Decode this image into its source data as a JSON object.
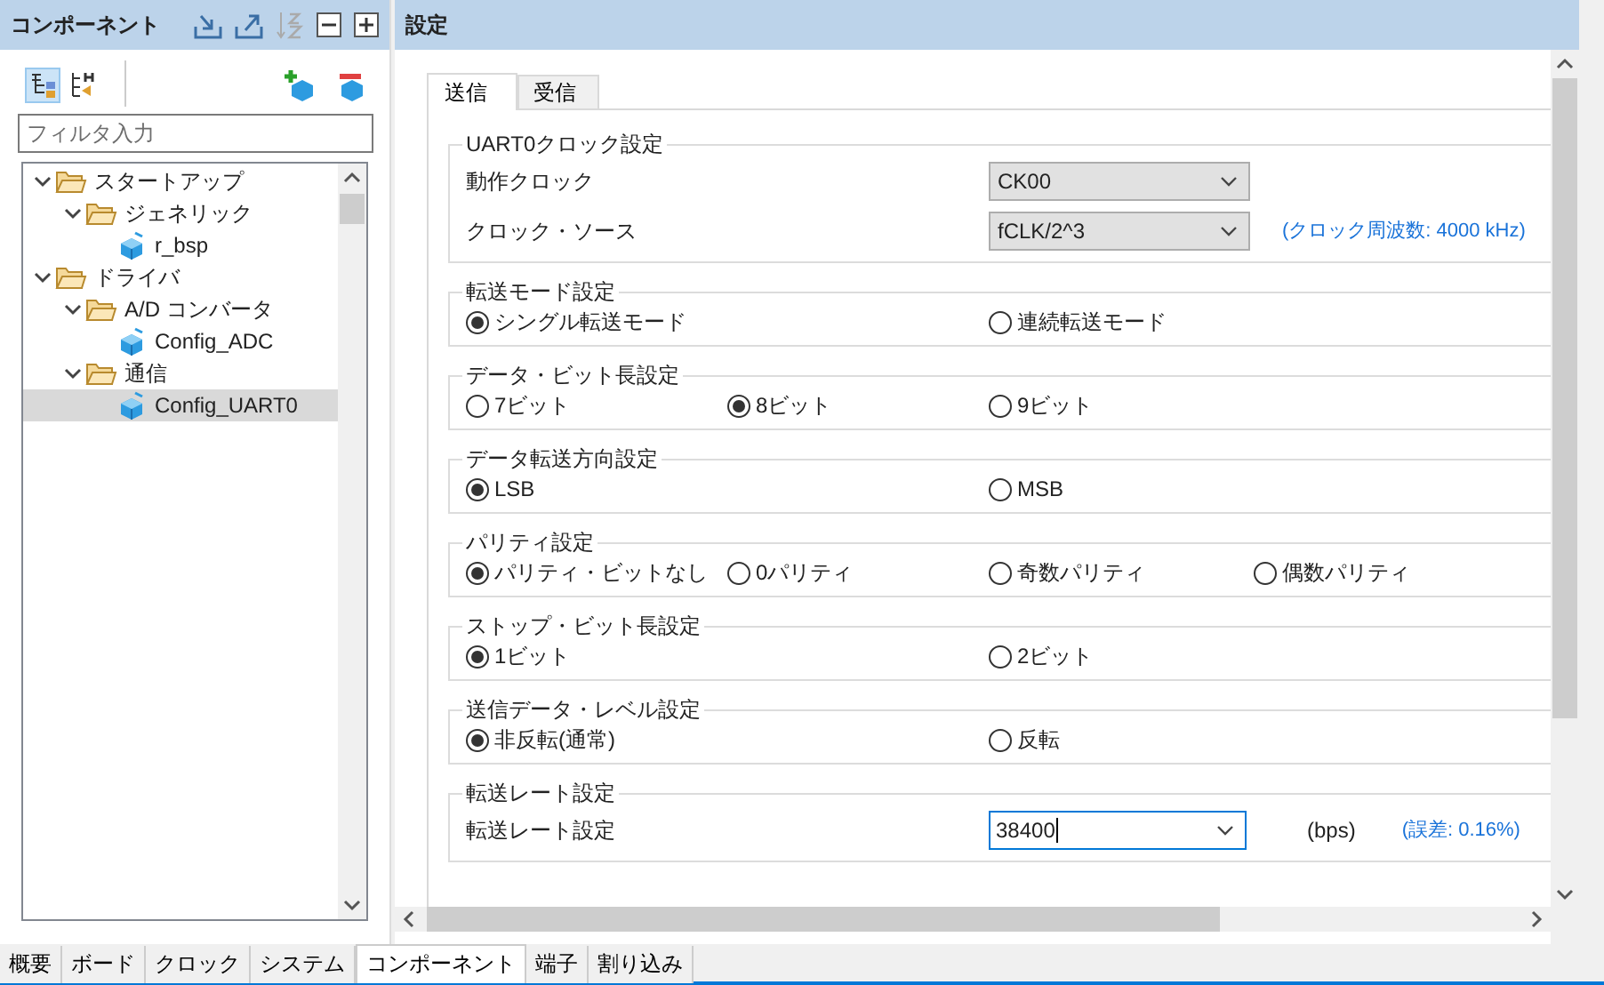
{
  "left_panel": {
    "title": "コンポーネント",
    "filter": {
      "placeholder": "フィルタ入力"
    },
    "tree": [
      {
        "label": "スタートアップ",
        "kind": "folder",
        "expanded": true,
        "selected": false,
        "children": [
          {
            "label": "ジェネリック",
            "kind": "folder",
            "expanded": true,
            "selected": false,
            "children": [
              {
                "label": "r_bsp",
                "kind": "component",
                "selected": false
              }
            ]
          }
        ]
      },
      {
        "label": "ドライバ",
        "kind": "folder",
        "expanded": true,
        "selected": false,
        "children": [
          {
            "label": "A/D コンバータ",
            "kind": "folder",
            "expanded": true,
            "selected": false,
            "children": [
              {
                "label": "Config_ADC",
                "kind": "component",
                "selected": false
              }
            ]
          },
          {
            "label": "通信",
            "kind": "folder",
            "expanded": true,
            "selected": false,
            "children": [
              {
                "label": "Config_UART0",
                "kind": "component",
                "selected": true
              }
            ]
          }
        ]
      }
    ]
  },
  "right_panel": {
    "title": "設定",
    "tabs": [
      {
        "label": "送信",
        "selected": true
      },
      {
        "label": "受信",
        "selected": false
      }
    ],
    "groups": [
      {
        "legend": "UART0クロック設定",
        "rows": [
          {
            "kind": "select",
            "label": "動作クロック",
            "value": "CK00"
          },
          {
            "kind": "select",
            "label": "クロック・ソース",
            "value": "fCLK/2^3",
            "note": "(クロック周波数: 4000 kHz)"
          }
        ]
      },
      {
        "legend": "転送モード設定",
        "rows": [
          {
            "kind": "radio",
            "options": [
              {
                "label": "シングル転送モード",
                "selected": true
              },
              {
                "label": "連続転送モード",
                "selected": false
              }
            ]
          }
        ]
      },
      {
        "legend": "データ・ビット長設定",
        "rows": [
          {
            "kind": "radio",
            "options": [
              {
                "label": "7ビット",
                "selected": false
              },
              {
                "label": "8ビット",
                "selected": true
              },
              {
                "label": "9ビット",
                "selected": false
              }
            ]
          }
        ]
      },
      {
        "legend": "データ転送方向設定",
        "rows": [
          {
            "kind": "radio",
            "options": [
              {
                "label": "LSB",
                "selected": true
              },
              {
                "label": "MSB",
                "selected": false
              }
            ]
          }
        ]
      },
      {
        "legend": "パリティ設定",
        "rows": [
          {
            "kind": "radio",
            "options": [
              {
                "label": "パリティ・ビットなし",
                "selected": true
              },
              {
                "label": "0パリティ",
                "selected": false
              },
              {
                "label": "奇数パリティ",
                "selected": false
              },
              {
                "label": "偶数パリティ",
                "selected": false
              }
            ]
          }
        ]
      },
      {
        "legend": "ストップ・ビット長設定",
        "rows": [
          {
            "kind": "radio",
            "options": [
              {
                "label": "1ビット",
                "selected": true
              },
              {
                "label": "2ビット",
                "selected": false
              }
            ]
          }
        ]
      },
      {
        "legend": "送信データ・レベル設定",
        "rows": [
          {
            "kind": "radio",
            "options": [
              {
                "label": "非反転(通常)",
                "selected": true
              },
              {
                "label": "反転",
                "selected": false
              }
            ]
          }
        ]
      },
      {
        "legend": "転送レート設定",
        "rows": [
          {
            "kind": "combo",
            "label": "転送レート設定",
            "value": "38400",
            "unit": "(bps)",
            "note": "(誤差: 0.16%)"
          }
        ]
      }
    ]
  },
  "bottom_tabs": [
    {
      "label": "概要",
      "selected": false
    },
    {
      "label": "ボード",
      "selected": false
    },
    {
      "label": "クロック",
      "selected": false
    },
    {
      "label": "システム",
      "selected": false
    },
    {
      "label": "コンポーネント",
      "selected": true
    },
    {
      "label": "端子",
      "selected": false
    },
    {
      "label": "割り込み",
      "selected": false
    }
  ]
}
